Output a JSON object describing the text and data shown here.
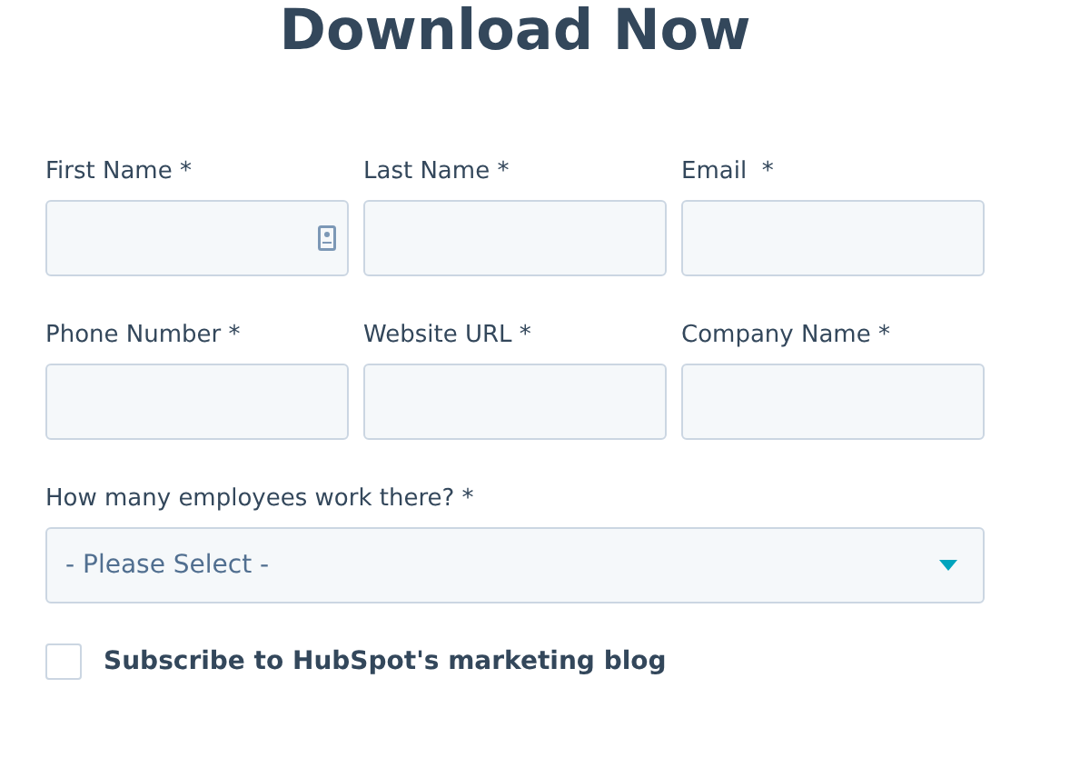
{
  "title": "Download Now",
  "fields": [
    {
      "label": "First Name *",
      "kind": "contact"
    },
    {
      "label": "Last Name *",
      "kind": "text"
    },
    {
      "label": "Email  *",
      "kind": "text"
    },
    {
      "label": "Phone Number *",
      "kind": "text"
    },
    {
      "label": "Website URL *",
      "kind": "text"
    },
    {
      "label": "Company Name *",
      "kind": "text"
    }
  ],
  "employees": {
    "label": "How many employees work there? *",
    "placeholder": "- Please Select -"
  },
  "subscribe": {
    "label": "Subscribe to HubSpot's marketing blog",
    "checked": false
  }
}
